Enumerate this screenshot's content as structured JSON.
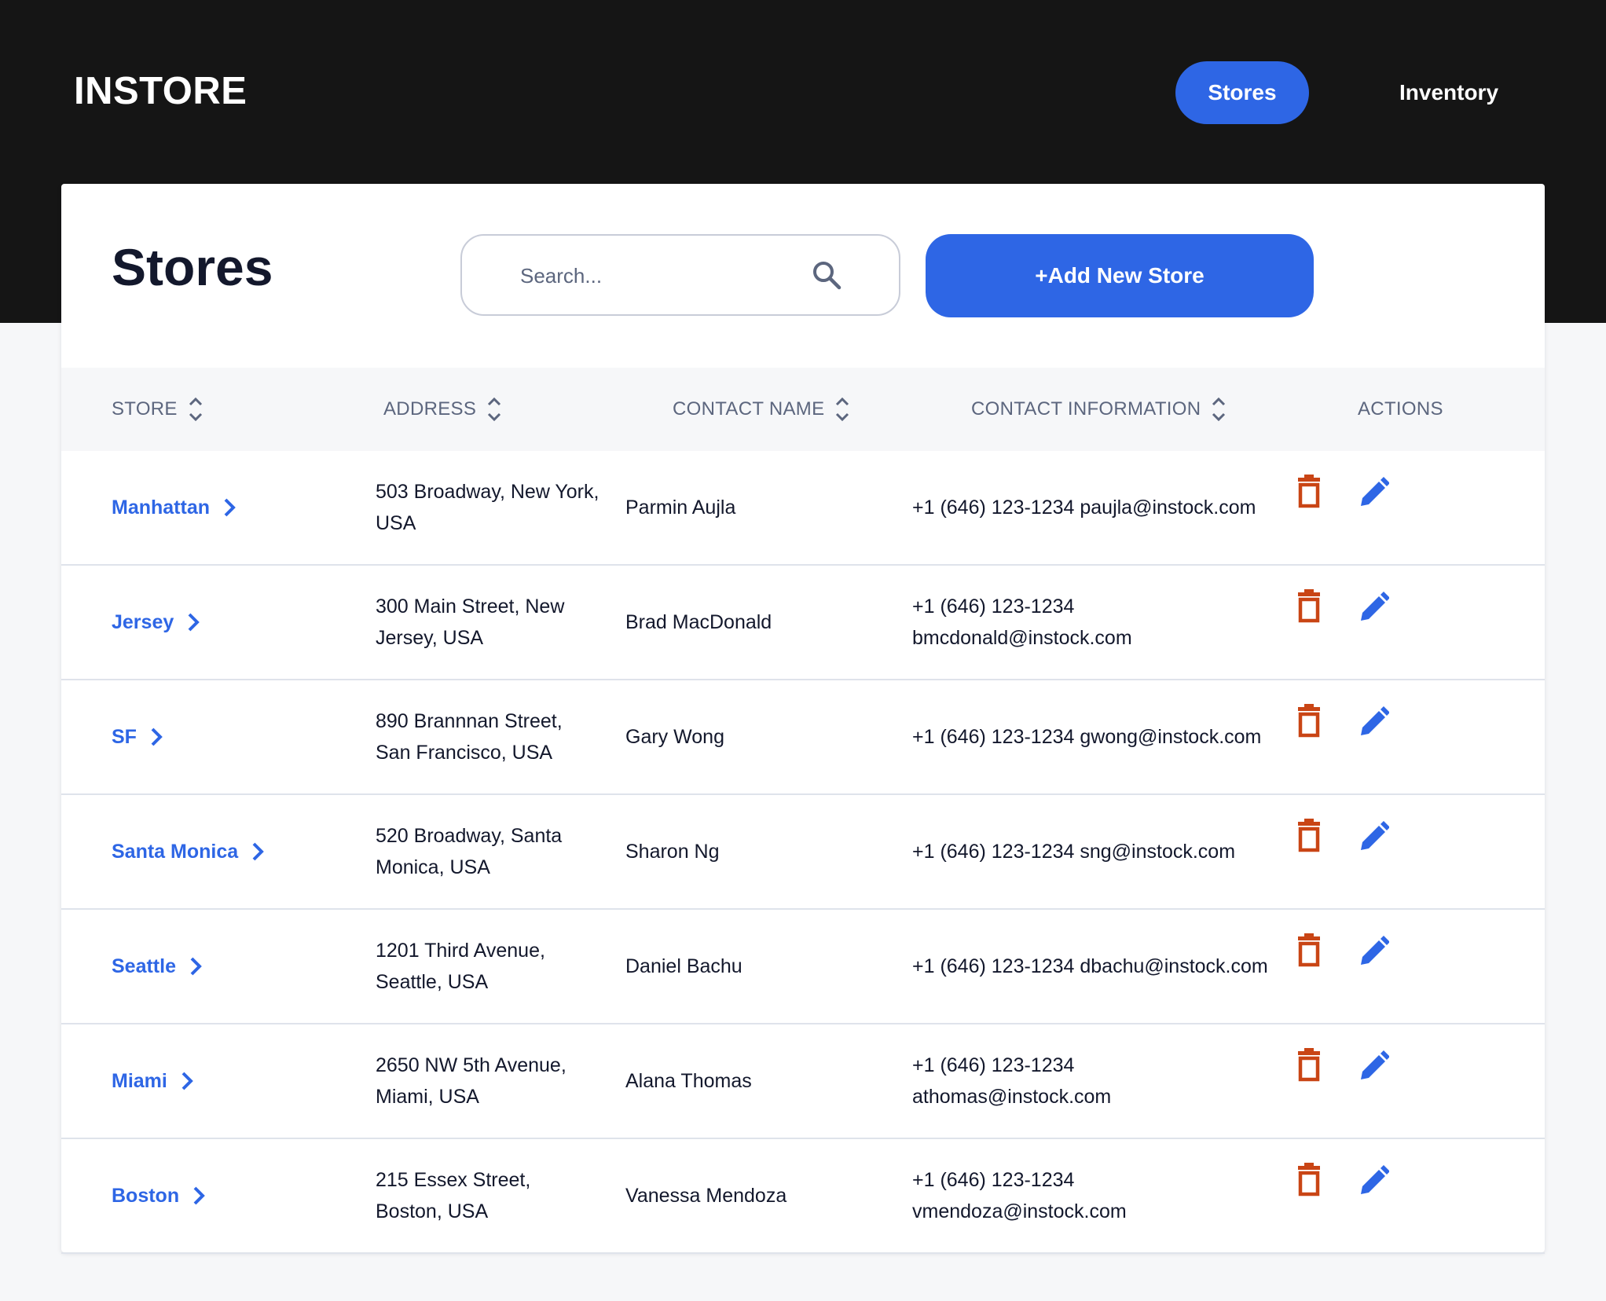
{
  "brand": {
    "logo": "INSTORE"
  },
  "nav": {
    "stores_label": "Stores",
    "inventory_label": "Inventory"
  },
  "page": {
    "title": "Stores",
    "search_placeholder": "Search...",
    "add_label": "+Add New Store"
  },
  "table": {
    "headers": {
      "store": "STORE",
      "address": "ADDRESS",
      "contact_name": "CONTACT NAME",
      "contact_info": "CONTACT INFORMATION",
      "actions": "ACTIONS"
    },
    "rows": [
      {
        "store": "Manhattan",
        "address_1": "503 Broadway, New York,",
        "address_2": "USA",
        "contact_name": "Parmin Aujla",
        "contact_1": "+1 (646) 123-1234 paujla@instock.com",
        "contact_2": ""
      },
      {
        "store": "Jersey",
        "address_1": "300 Main Street, New",
        "address_2": "Jersey, USA",
        "contact_name": "Brad MacDonald",
        "contact_1": "+1 (646) 123-1234",
        "contact_2": "bmcdonald@instock.com"
      },
      {
        "store": "SF",
        "address_1": "890 Brannnan Street,",
        "address_2": "San Francisco, USA",
        "contact_name": "Gary Wong",
        "contact_1": "+1 (646) 123-1234 gwong@instock.com",
        "contact_2": ""
      },
      {
        "store": "Santa Monica",
        "address_1": "520 Broadway, Santa",
        "address_2": "Monica, USA",
        "contact_name": "Sharon Ng",
        "contact_1": "+1 (646) 123-1234 sng@instock.com",
        "contact_2": ""
      },
      {
        "store": "Seattle",
        "address_1": "1201 Third Avenue,",
        "address_2": "Seattle, USA",
        "contact_name": "Daniel Bachu",
        "contact_1": "+1 (646) 123-1234 dbachu@instock.com",
        "contact_2": ""
      },
      {
        "store": "Miami",
        "address_1": "2650 NW 5th Avenue,",
        "address_2": "Miami, USA",
        "contact_name": "Alana Thomas",
        "contact_1": "+1 (646) 123-1234",
        "contact_2": "athomas@instock.com"
      },
      {
        "store": "Boston",
        "address_1": "215 Essex Street,",
        "address_2": "Boston, USA",
        "contact_name": "Vanessa Mendoza",
        "contact_1": "+1 (646) 123-1234",
        "contact_2": "vmendoza@instock.com"
      }
    ]
  },
  "icons": {
    "search": "search-icon",
    "sort": "sort-icon",
    "chevron": "chevron-right-icon",
    "delete": "trash-icon",
    "edit": "pencil-icon"
  },
  "colors": {
    "header_bg": "#151515",
    "accent": "#2e66e5",
    "delete": "#c94515",
    "text": "#13182c",
    "muted": "#5c667e",
    "divider": "#dfe3eb",
    "page_bg": "#f6f7f9"
  }
}
